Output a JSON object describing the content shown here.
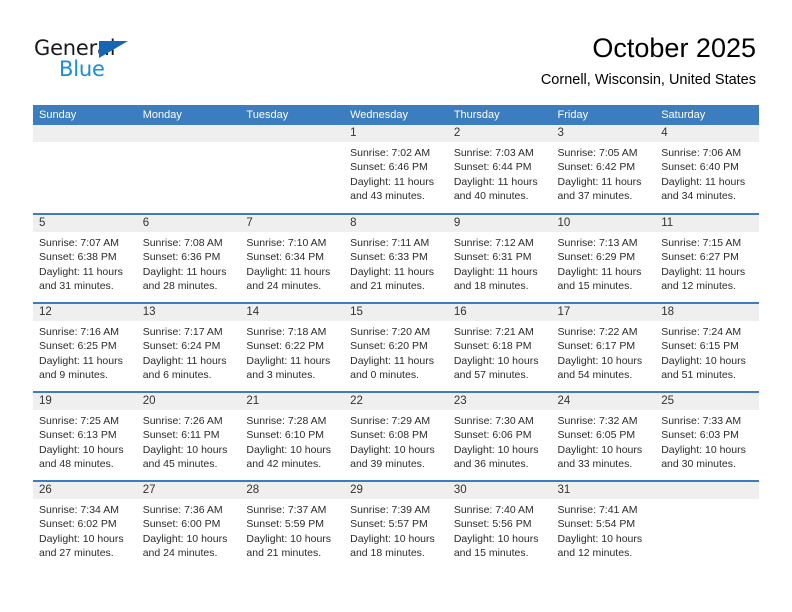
{
  "brand": {
    "name_part1": "General",
    "name_part2": "Blue",
    "triangle_color": "#1567b5",
    "blue_color": "#1a8cdc"
  },
  "header": {
    "title": "October 2025",
    "subtitle": "Cornell, Wisconsin, United States"
  },
  "theme": {
    "header_band": "#3b7dbf",
    "daynum_band": "#efefef",
    "text": "#2b2b2b"
  },
  "weekdays": [
    "Sunday",
    "Monday",
    "Tuesday",
    "Wednesday",
    "Thursday",
    "Friday",
    "Saturday"
  ],
  "weeks": [
    [
      {
        "day": "",
        "sunrise": "",
        "sunset": "",
        "daylight_1": "",
        "daylight_2": ""
      },
      {
        "day": "",
        "sunrise": "",
        "sunset": "",
        "daylight_1": "",
        "daylight_2": ""
      },
      {
        "day": "",
        "sunrise": "",
        "sunset": "",
        "daylight_1": "",
        "daylight_2": ""
      },
      {
        "day": "1",
        "sunrise": "Sunrise: 7:02 AM",
        "sunset": "Sunset: 6:46 PM",
        "daylight_1": "Daylight: 11 hours",
        "daylight_2": "and 43 minutes."
      },
      {
        "day": "2",
        "sunrise": "Sunrise: 7:03 AM",
        "sunset": "Sunset: 6:44 PM",
        "daylight_1": "Daylight: 11 hours",
        "daylight_2": "and 40 minutes."
      },
      {
        "day": "3",
        "sunrise": "Sunrise: 7:05 AM",
        "sunset": "Sunset: 6:42 PM",
        "daylight_1": "Daylight: 11 hours",
        "daylight_2": "and 37 minutes."
      },
      {
        "day": "4",
        "sunrise": "Sunrise: 7:06 AM",
        "sunset": "Sunset: 6:40 PM",
        "daylight_1": "Daylight: 11 hours",
        "daylight_2": "and 34 minutes."
      }
    ],
    [
      {
        "day": "5",
        "sunrise": "Sunrise: 7:07 AM",
        "sunset": "Sunset: 6:38 PM",
        "daylight_1": "Daylight: 11 hours",
        "daylight_2": "and 31 minutes."
      },
      {
        "day": "6",
        "sunrise": "Sunrise: 7:08 AM",
        "sunset": "Sunset: 6:36 PM",
        "daylight_1": "Daylight: 11 hours",
        "daylight_2": "and 28 minutes."
      },
      {
        "day": "7",
        "sunrise": "Sunrise: 7:10 AM",
        "sunset": "Sunset: 6:34 PM",
        "daylight_1": "Daylight: 11 hours",
        "daylight_2": "and 24 minutes."
      },
      {
        "day": "8",
        "sunrise": "Sunrise: 7:11 AM",
        "sunset": "Sunset: 6:33 PM",
        "daylight_1": "Daylight: 11 hours",
        "daylight_2": "and 21 minutes."
      },
      {
        "day": "9",
        "sunrise": "Sunrise: 7:12 AM",
        "sunset": "Sunset: 6:31 PM",
        "daylight_1": "Daylight: 11 hours",
        "daylight_2": "and 18 minutes."
      },
      {
        "day": "10",
        "sunrise": "Sunrise: 7:13 AM",
        "sunset": "Sunset: 6:29 PM",
        "daylight_1": "Daylight: 11 hours",
        "daylight_2": "and 15 minutes."
      },
      {
        "day": "11",
        "sunrise": "Sunrise: 7:15 AM",
        "sunset": "Sunset: 6:27 PM",
        "daylight_1": "Daylight: 11 hours",
        "daylight_2": "and 12 minutes."
      }
    ],
    [
      {
        "day": "12",
        "sunrise": "Sunrise: 7:16 AM",
        "sunset": "Sunset: 6:25 PM",
        "daylight_1": "Daylight: 11 hours",
        "daylight_2": "and 9 minutes."
      },
      {
        "day": "13",
        "sunrise": "Sunrise: 7:17 AM",
        "sunset": "Sunset: 6:24 PM",
        "daylight_1": "Daylight: 11 hours",
        "daylight_2": "and 6 minutes."
      },
      {
        "day": "14",
        "sunrise": "Sunrise: 7:18 AM",
        "sunset": "Sunset: 6:22 PM",
        "daylight_1": "Daylight: 11 hours",
        "daylight_2": "and 3 minutes."
      },
      {
        "day": "15",
        "sunrise": "Sunrise: 7:20 AM",
        "sunset": "Sunset: 6:20 PM",
        "daylight_1": "Daylight: 11 hours",
        "daylight_2": "and 0 minutes."
      },
      {
        "day": "16",
        "sunrise": "Sunrise: 7:21 AM",
        "sunset": "Sunset: 6:18 PM",
        "daylight_1": "Daylight: 10 hours",
        "daylight_2": "and 57 minutes."
      },
      {
        "day": "17",
        "sunrise": "Sunrise: 7:22 AM",
        "sunset": "Sunset: 6:17 PM",
        "daylight_1": "Daylight: 10 hours",
        "daylight_2": "and 54 minutes."
      },
      {
        "day": "18",
        "sunrise": "Sunrise: 7:24 AM",
        "sunset": "Sunset: 6:15 PM",
        "daylight_1": "Daylight: 10 hours",
        "daylight_2": "and 51 minutes."
      }
    ],
    [
      {
        "day": "19",
        "sunrise": "Sunrise: 7:25 AM",
        "sunset": "Sunset: 6:13 PM",
        "daylight_1": "Daylight: 10 hours",
        "daylight_2": "and 48 minutes."
      },
      {
        "day": "20",
        "sunrise": "Sunrise: 7:26 AM",
        "sunset": "Sunset: 6:11 PM",
        "daylight_1": "Daylight: 10 hours",
        "daylight_2": "and 45 minutes."
      },
      {
        "day": "21",
        "sunrise": "Sunrise: 7:28 AM",
        "sunset": "Sunset: 6:10 PM",
        "daylight_1": "Daylight: 10 hours",
        "daylight_2": "and 42 minutes."
      },
      {
        "day": "22",
        "sunrise": "Sunrise: 7:29 AM",
        "sunset": "Sunset: 6:08 PM",
        "daylight_1": "Daylight: 10 hours",
        "daylight_2": "and 39 minutes."
      },
      {
        "day": "23",
        "sunrise": "Sunrise: 7:30 AM",
        "sunset": "Sunset: 6:06 PM",
        "daylight_1": "Daylight: 10 hours",
        "daylight_2": "and 36 minutes."
      },
      {
        "day": "24",
        "sunrise": "Sunrise: 7:32 AM",
        "sunset": "Sunset: 6:05 PM",
        "daylight_1": "Daylight: 10 hours",
        "daylight_2": "and 33 minutes."
      },
      {
        "day": "25",
        "sunrise": "Sunrise: 7:33 AM",
        "sunset": "Sunset: 6:03 PM",
        "daylight_1": "Daylight: 10 hours",
        "daylight_2": "and 30 minutes."
      }
    ],
    [
      {
        "day": "26",
        "sunrise": "Sunrise: 7:34 AM",
        "sunset": "Sunset: 6:02 PM",
        "daylight_1": "Daylight: 10 hours",
        "daylight_2": "and 27 minutes."
      },
      {
        "day": "27",
        "sunrise": "Sunrise: 7:36 AM",
        "sunset": "Sunset: 6:00 PM",
        "daylight_1": "Daylight: 10 hours",
        "daylight_2": "and 24 minutes."
      },
      {
        "day": "28",
        "sunrise": "Sunrise: 7:37 AM",
        "sunset": "Sunset: 5:59 PM",
        "daylight_1": "Daylight: 10 hours",
        "daylight_2": "and 21 minutes."
      },
      {
        "day": "29",
        "sunrise": "Sunrise: 7:39 AM",
        "sunset": "Sunset: 5:57 PM",
        "daylight_1": "Daylight: 10 hours",
        "daylight_2": "and 18 minutes."
      },
      {
        "day": "30",
        "sunrise": "Sunrise: 7:40 AM",
        "sunset": "Sunset: 5:56 PM",
        "daylight_1": "Daylight: 10 hours",
        "daylight_2": "and 15 minutes."
      },
      {
        "day": "31",
        "sunrise": "Sunrise: 7:41 AM",
        "sunset": "Sunset: 5:54 PM",
        "daylight_1": "Daylight: 10 hours",
        "daylight_2": "and 12 minutes."
      },
      {
        "day": "",
        "sunrise": "",
        "sunset": "",
        "daylight_1": "",
        "daylight_2": ""
      }
    ]
  ]
}
